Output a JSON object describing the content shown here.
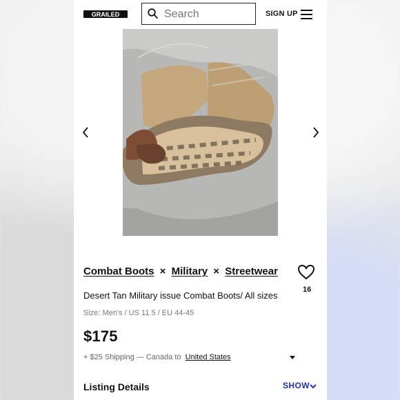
{
  "header": {
    "logo_text": "GRAILED",
    "search_placeholder": "Search",
    "signup_label": "SIGN UP"
  },
  "listing": {
    "designers": [
      "Combat Boots",
      "Military",
      "Streetwear"
    ],
    "separator": "×",
    "title": "Desert Tan Military issue Combat Boots/ All sizes",
    "size": "Size: Men's / US 11.5 / EU 44-45",
    "price": "$175",
    "favorites_count": "16",
    "shipping": {
      "prefix": "+ $25 Shipping — Canada to",
      "country": "United States"
    },
    "details_label": "Listing Details",
    "show_label": "SHOW"
  },
  "icons": {
    "search": "search-icon",
    "menu": "menu-icon",
    "previous": "chevron-left-icon",
    "next": "chevron-right-icon",
    "favorite": "heart-icon",
    "dropdown": "caret-down-icon",
    "expand": "chevron-down-icon"
  },
  "colors": {
    "accent": "#2131a8",
    "background": "#ffffff",
    "text": "#111111"
  }
}
